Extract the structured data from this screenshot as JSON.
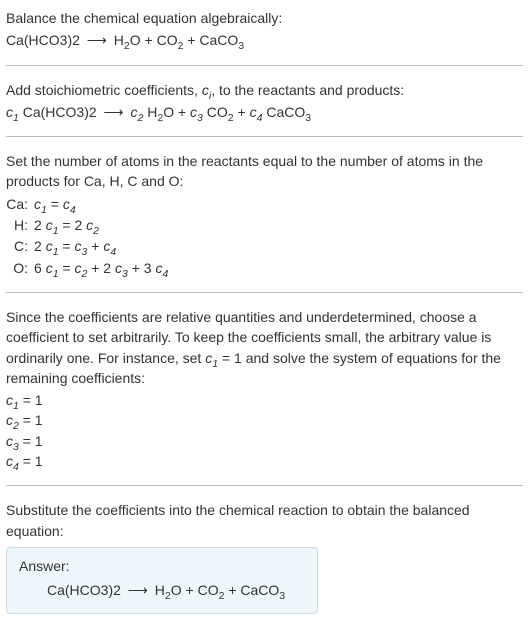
{
  "intro": {
    "line1": "Balance the chemical equation algebraically:",
    "eq_lhs": "Ca(HCO3)2",
    "arrow": "⟶",
    "eq_rhs_1": "H",
    "eq_rhs_1s": "2",
    "eq_rhs_1b": "O + CO",
    "eq_rhs_1bs": "2",
    "eq_rhs_1c": " + CaCO",
    "eq_rhs_1cs": "3"
  },
  "stoich": {
    "text": "Add stoichiometric coefficients, ",
    "ci": "c",
    "ci_sub": "i",
    "text2": ", to the reactants and products:",
    "c1": "c",
    "c1s": "1",
    "sp1": " Ca(HCO3)2",
    "arrow": "⟶",
    "c2": "c",
    "c2s": "2",
    "sp2": " H",
    "sp2a": "2",
    "sp2b": "O + ",
    "c3": "c",
    "c3s": "3",
    "sp3": " CO",
    "sp3a": "2",
    "sp3b": " + ",
    "c4": "c",
    "c4s": "4",
    "sp4": " CaCO",
    "sp4a": "3"
  },
  "atoms": {
    "text": "Set the number of atoms in the reactants equal to the number of atoms in the products for Ca, H, C and O:",
    "rows": [
      {
        "label": "Ca:",
        "c_a": "c",
        "a": "1",
        "mid": " = ",
        "c_b": "c",
        "b": "4",
        "pre": "",
        "pre2": "",
        "mid2": "",
        "c_c": "",
        "c": "",
        "post": ""
      },
      {
        "label": "H:",
        "pre": "2 ",
        "c_a": "c",
        "a": "1",
        "mid": " = 2 ",
        "c_b": "c",
        "b": "2",
        "pre2": "",
        "mid2": "",
        "c_c": "",
        "c": "",
        "post": ""
      },
      {
        "label": "C:",
        "pre": "2 ",
        "c_a": "c",
        "a": "1",
        "mid": " = ",
        "c_b": "c",
        "b": "3",
        "pre2": "",
        "mid2": " + ",
        "c_c": "c",
        "c": "4",
        "post": ""
      },
      {
        "label": "O:",
        "pre": "6 ",
        "c_a": "c",
        "a": "1",
        "mid": " = ",
        "c_b": "c",
        "b": "2",
        "pre2": "",
        "mid2": " + 2 ",
        "c_c": "c",
        "c": "3",
        "post_pre": " + 3 ",
        "c_d": "c",
        "d": "4"
      }
    ]
  },
  "choose": {
    "p1a": "Since the coefficients are relative quantities and underdetermined, choose a coefficient to set arbitrarily. To keep the coefficients small, the arbitrary value is ordinarily one. For instance, set ",
    "c": "c",
    "cs": "1",
    "p1b": " = 1 and solve the system of equations for the remaining coefficients:",
    "coeffs": [
      {
        "c": "c",
        "s": "1",
        "eq": " = 1"
      },
      {
        "c": "c",
        "s": "2",
        "eq": " = 1"
      },
      {
        "c": "c",
        "s": "3",
        "eq": " = 1"
      },
      {
        "c": "c",
        "s": "4",
        "eq": " = 1"
      }
    ]
  },
  "subst": {
    "text": "Substitute the coefficients into the chemical reaction to obtain the balanced equation:"
  },
  "answer": {
    "title": "Answer:",
    "lhs": "Ca(HCO3)2",
    "arrow": "⟶",
    "r1": "H",
    "r1s": "2",
    "r2": "O + CO",
    "r2s": "2",
    "r3": " + CaCO",
    "r3s": "3"
  }
}
